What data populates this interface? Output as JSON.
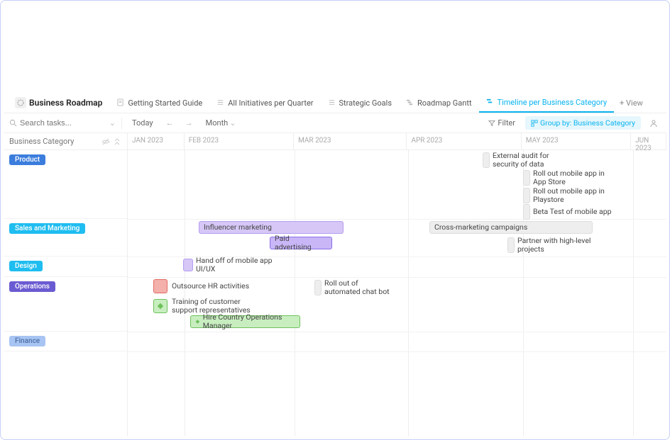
{
  "breadcrumb": {
    "title": "Business Roadmap"
  },
  "tabs": [
    {
      "label": "Getting Started Guide"
    },
    {
      "label": "All Initiatives per Quarter"
    },
    {
      "label": "Strategic Goals"
    },
    {
      "label": "Roadmap Gantt"
    },
    {
      "label": "Timeline per Business Category"
    }
  ],
  "add_view_label": "View",
  "toolbar": {
    "search_placeholder": "Search tasks...",
    "today": "Today",
    "scale": "Month",
    "filter": "Filter",
    "groupby": "Group by: Business Category"
  },
  "category_header": "Business Category",
  "months": [
    "JAN 2023",
    "FEB 2023",
    "MAR 2023",
    "APR 2023",
    "MAY 2023",
    "JUN 2023"
  ],
  "categories": [
    {
      "name": "Product",
      "color": "#3b7ddd"
    },
    {
      "name": "Sales and Marketing",
      "color": "#1fbdf0"
    },
    {
      "name": "Design",
      "color": "#1fbdf0"
    },
    {
      "name": "Operations",
      "color": "#6b5bd2"
    },
    {
      "name": "Finance",
      "color": "#a7c4f2"
    }
  ],
  "tasks": {
    "product": [
      {
        "label": "External audit for security of data"
      },
      {
        "label": "Roll out mobile app in App Store"
      },
      {
        "label": "Roll out mobile app in Playstore"
      },
      {
        "label": "Beta Test of mobile app"
      }
    ],
    "sales": [
      {
        "label": "Influencer marketing"
      },
      {
        "label": "Paid advertising"
      },
      {
        "label": "Cross-marketing campaigns"
      },
      {
        "label": "Partner with high-level projects"
      }
    ],
    "design": [
      {
        "label": "Hand off of mobile app UI/UX"
      }
    ],
    "operations": [
      {
        "label": "Outsource HR activities"
      },
      {
        "label": "Training of customer support representatives"
      },
      {
        "label": "Hire Country Operations Manager"
      },
      {
        "label": "Roll out of automated chat bot"
      }
    ]
  },
  "colors": {
    "purple_light": "#d6c7f7",
    "purple_border": "#8a6fe8",
    "green_light": "#c8eec0",
    "green_border": "#6fc15c",
    "red_light": "#f4b0ab",
    "red_border": "#e26b63",
    "grey_light": "#eeeeee",
    "blue_light": "#e8f3fb"
  }
}
